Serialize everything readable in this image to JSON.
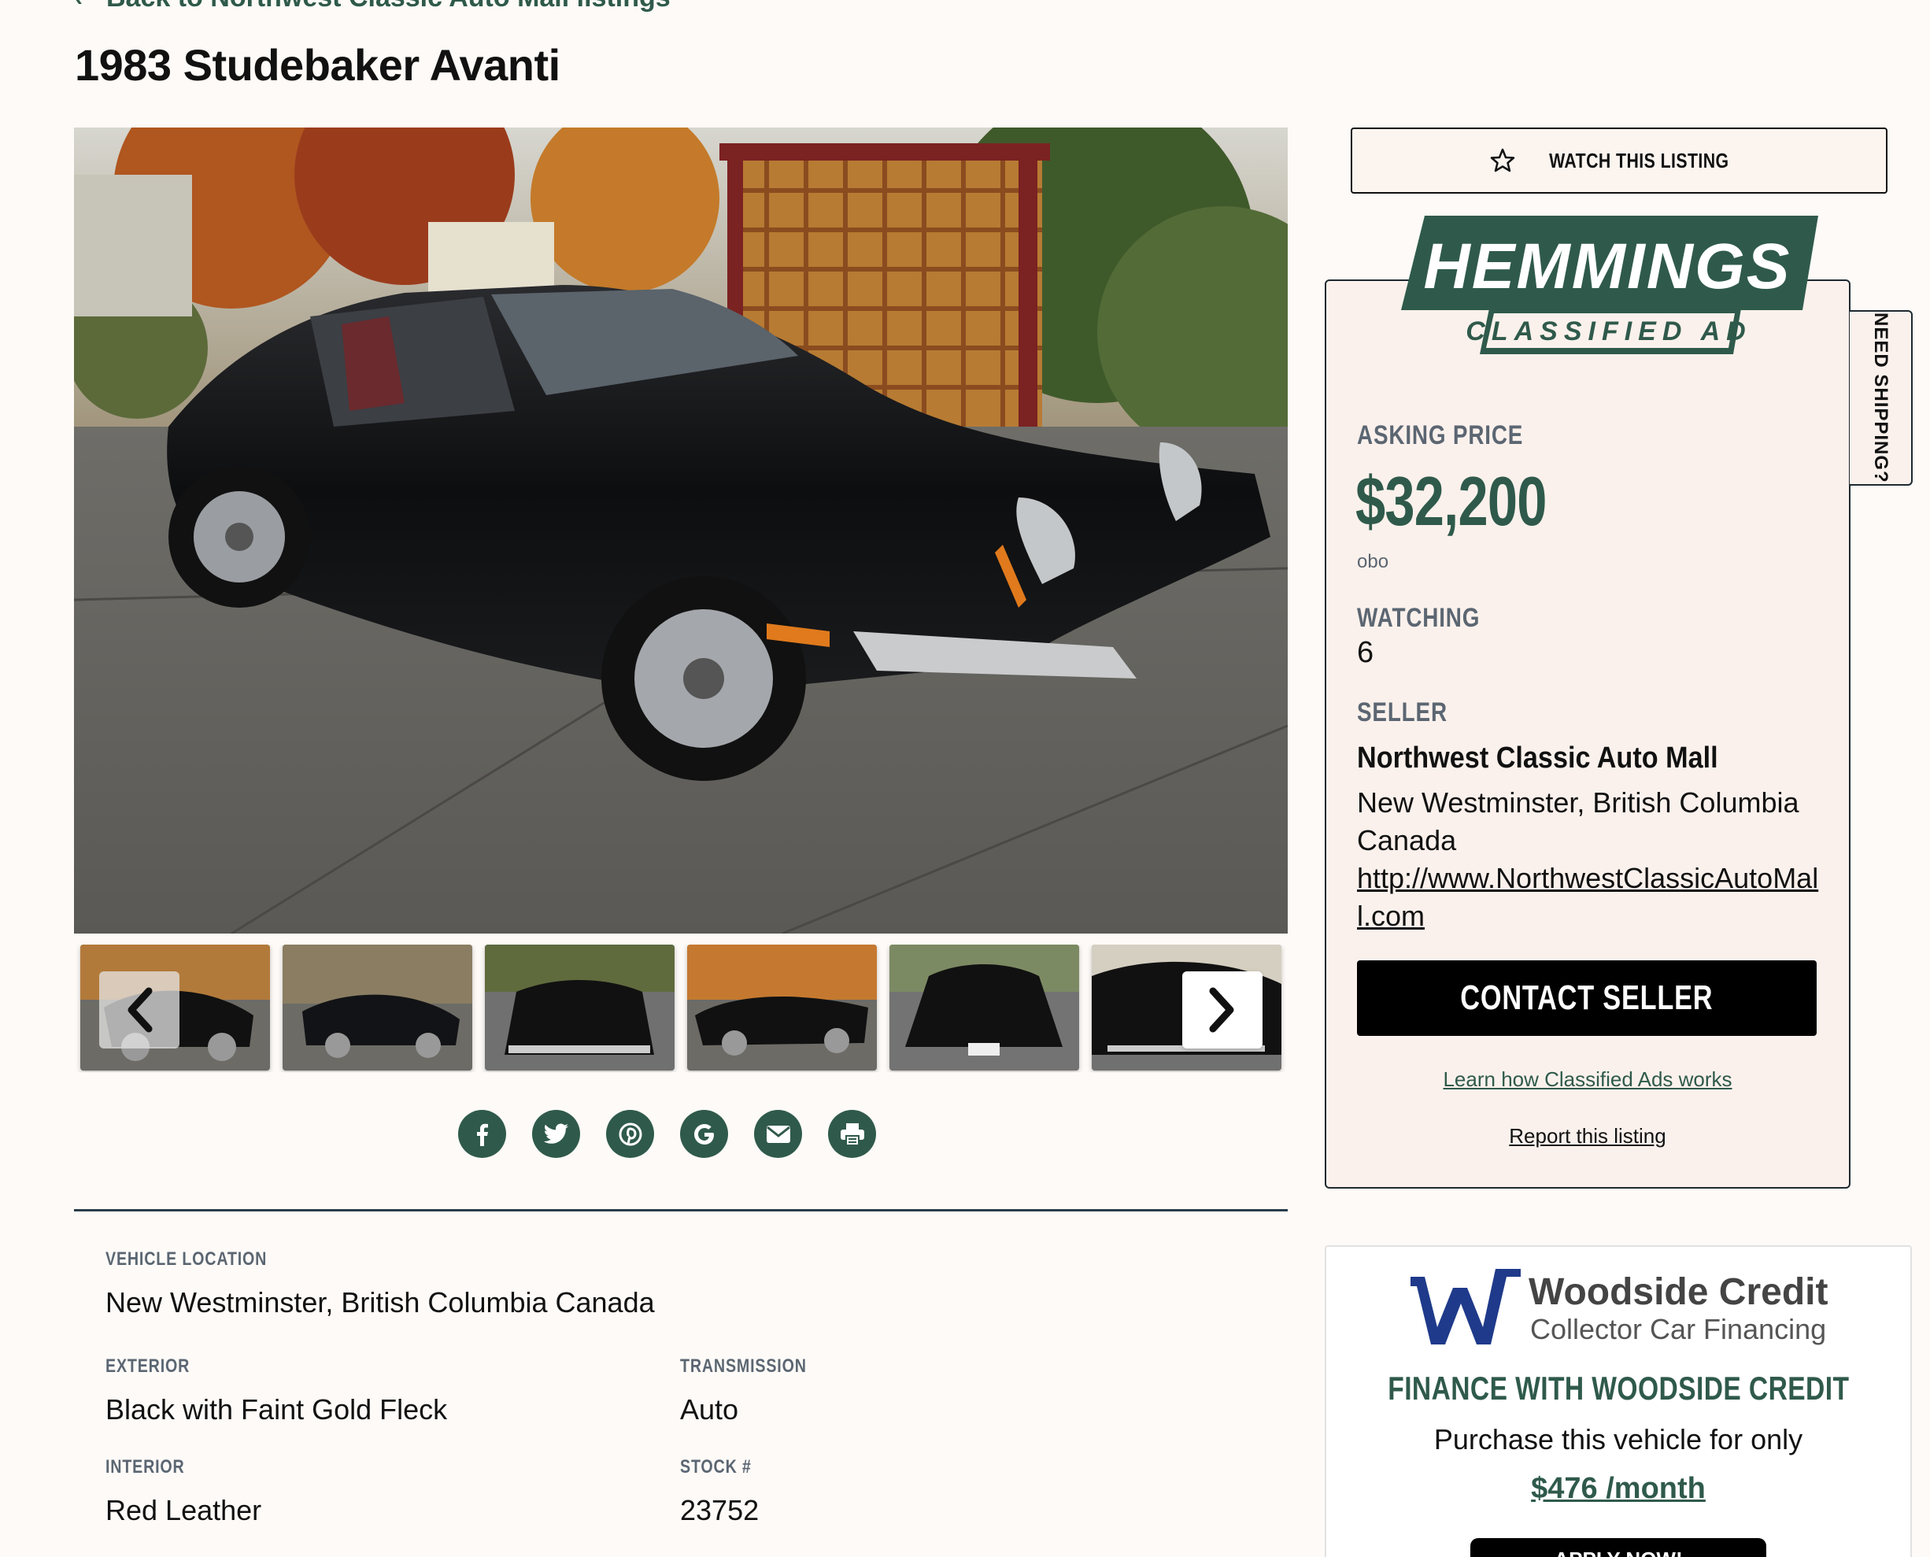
{
  "nav": {
    "back_label": "Back to Northwest Classic Auto Mall listings"
  },
  "listing": {
    "title": "1983 Studebaker Avanti"
  },
  "actions": {
    "watch_label": "WATCH THIS LISTING"
  },
  "sidebar": {
    "shipping_tab": "NEED SHIPPING?",
    "logo": {
      "brand": "HEMMINGS",
      "sub": "CLASSIFIED AD"
    },
    "asking_label": "ASKING PRICE",
    "price": "$32,200",
    "price_note": "obo",
    "watching_label": "WATCHING",
    "watching_count": "6",
    "seller_label": "SELLER",
    "seller_name": "Northwest Classic Auto Mall",
    "seller_location": "New Westminster, British Columbia Canada",
    "seller_url": "http://www.NorthwestClassicAutoMall.com",
    "contact_label": "CONTACT SELLER",
    "learn_link": "Learn how Classified Ads works",
    "report_link": "Report this listing"
  },
  "specs": {
    "location_label": "VEHICLE LOCATION",
    "location_value": "New Westminster, British Columbia Canada",
    "exterior_label": "EXTERIOR",
    "exterior_value": "Black with Faint Gold Fleck",
    "transmission_label": "TRANSMISSION",
    "transmission_value": "Auto",
    "interior_label": "INTERIOR",
    "interior_value": "Red Leather",
    "stock_label": "STOCK #",
    "stock_value": "23752"
  },
  "share_icons": [
    "facebook-icon",
    "twitter-icon",
    "pinterest-icon",
    "google-icon",
    "email-icon",
    "print-icon"
  ],
  "finance": {
    "brand_title": "Woodside Credit",
    "brand_sub": "Collector Car Financing",
    "title": "FINANCE WITH WOODSIDE CREDIT",
    "text": "Purchase this vehicle for only",
    "amount": "$476 /month",
    "apply_label": "APPLY NOW!"
  },
  "colors": {
    "accent": "#2f5a4b",
    "background": "#fdfaf7",
    "label_gray": "#5b6672"
  }
}
